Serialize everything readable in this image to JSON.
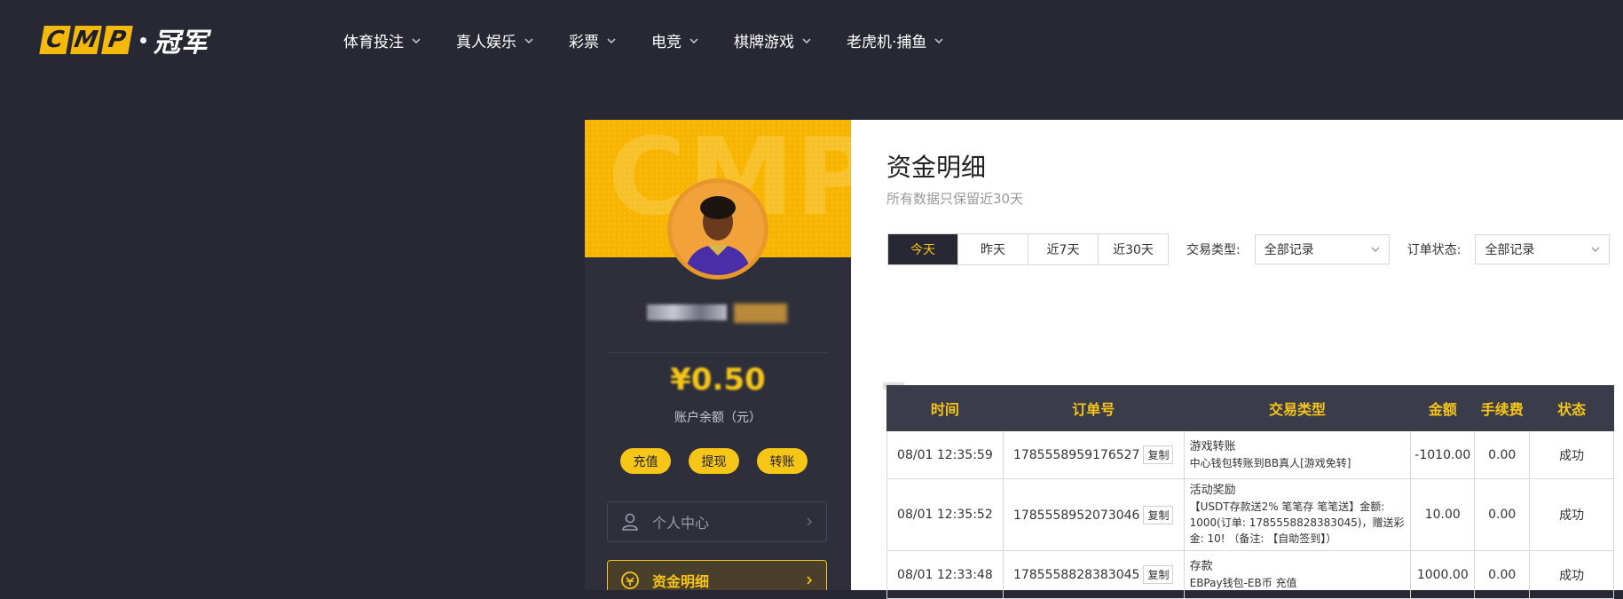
{
  "brand": {
    "logo_letters": [
      "C",
      "M",
      "P"
    ],
    "logo_suffix": "冠军"
  },
  "nav": [
    {
      "label": "体育投注"
    },
    {
      "label": "真人娱乐"
    },
    {
      "label": "彩票"
    },
    {
      "label": "电竞"
    },
    {
      "label": "棋牌游戏"
    },
    {
      "label": "老虎机·捕鱼"
    }
  ],
  "profile": {
    "banner_watermark": "CMP",
    "balance": "¥0.50",
    "balance_label": "账户余额（元）",
    "actions": [
      "充值",
      "提现",
      "转账"
    ],
    "menu": [
      {
        "label": "个人中心",
        "icon": "user-icon",
        "active": false
      },
      {
        "label": "资金明细",
        "icon": "fund-icon",
        "active": true
      }
    ]
  },
  "content": {
    "title": "资金明细",
    "subtitle": "所有数据只保留近30天",
    "ranges": [
      "今天",
      "昨天",
      "近7天",
      "近30天"
    ],
    "active_range": "今天",
    "type_filter_label": "交易类型:",
    "type_filter_value": "全部记录",
    "status_filter_label": "订单状态:",
    "status_filter_value": "全部记录",
    "columns": [
      "时间",
      "订单号",
      "交易类型",
      "金额",
      "手续费",
      "状态"
    ],
    "copy_label": "复制",
    "rows": [
      {
        "time": "08/01 12:35:59",
        "order": "1785558959176527",
        "type": "游戏转账",
        "desc": "中心钱包转账到BB真人[游戏免转]",
        "amount": "-1010.00",
        "fee": "0.00",
        "status": "成功"
      },
      {
        "time": "08/01 12:35:52",
        "order": "1785558952073046",
        "type": "活动奖励",
        "desc": "【USDT存款送2% 笔笔存 笔笔送】金额: 1000(订单: 1785558828383045)，赠送彩金: 10! （备注: 【自助签到】）",
        "amount": "10.00",
        "fee": "0.00",
        "status": "成功"
      },
      {
        "time": "08/01 12:33:48",
        "order": "1785558828383045",
        "type": "存款",
        "desc": "EBPay钱包-EB币 充值",
        "amount": "1000.00",
        "fee": "0.00",
        "status": "成功"
      }
    ]
  },
  "colors": {
    "accent": "#f5c518",
    "dark": "#272834",
    "success": "#2aa52a"
  }
}
